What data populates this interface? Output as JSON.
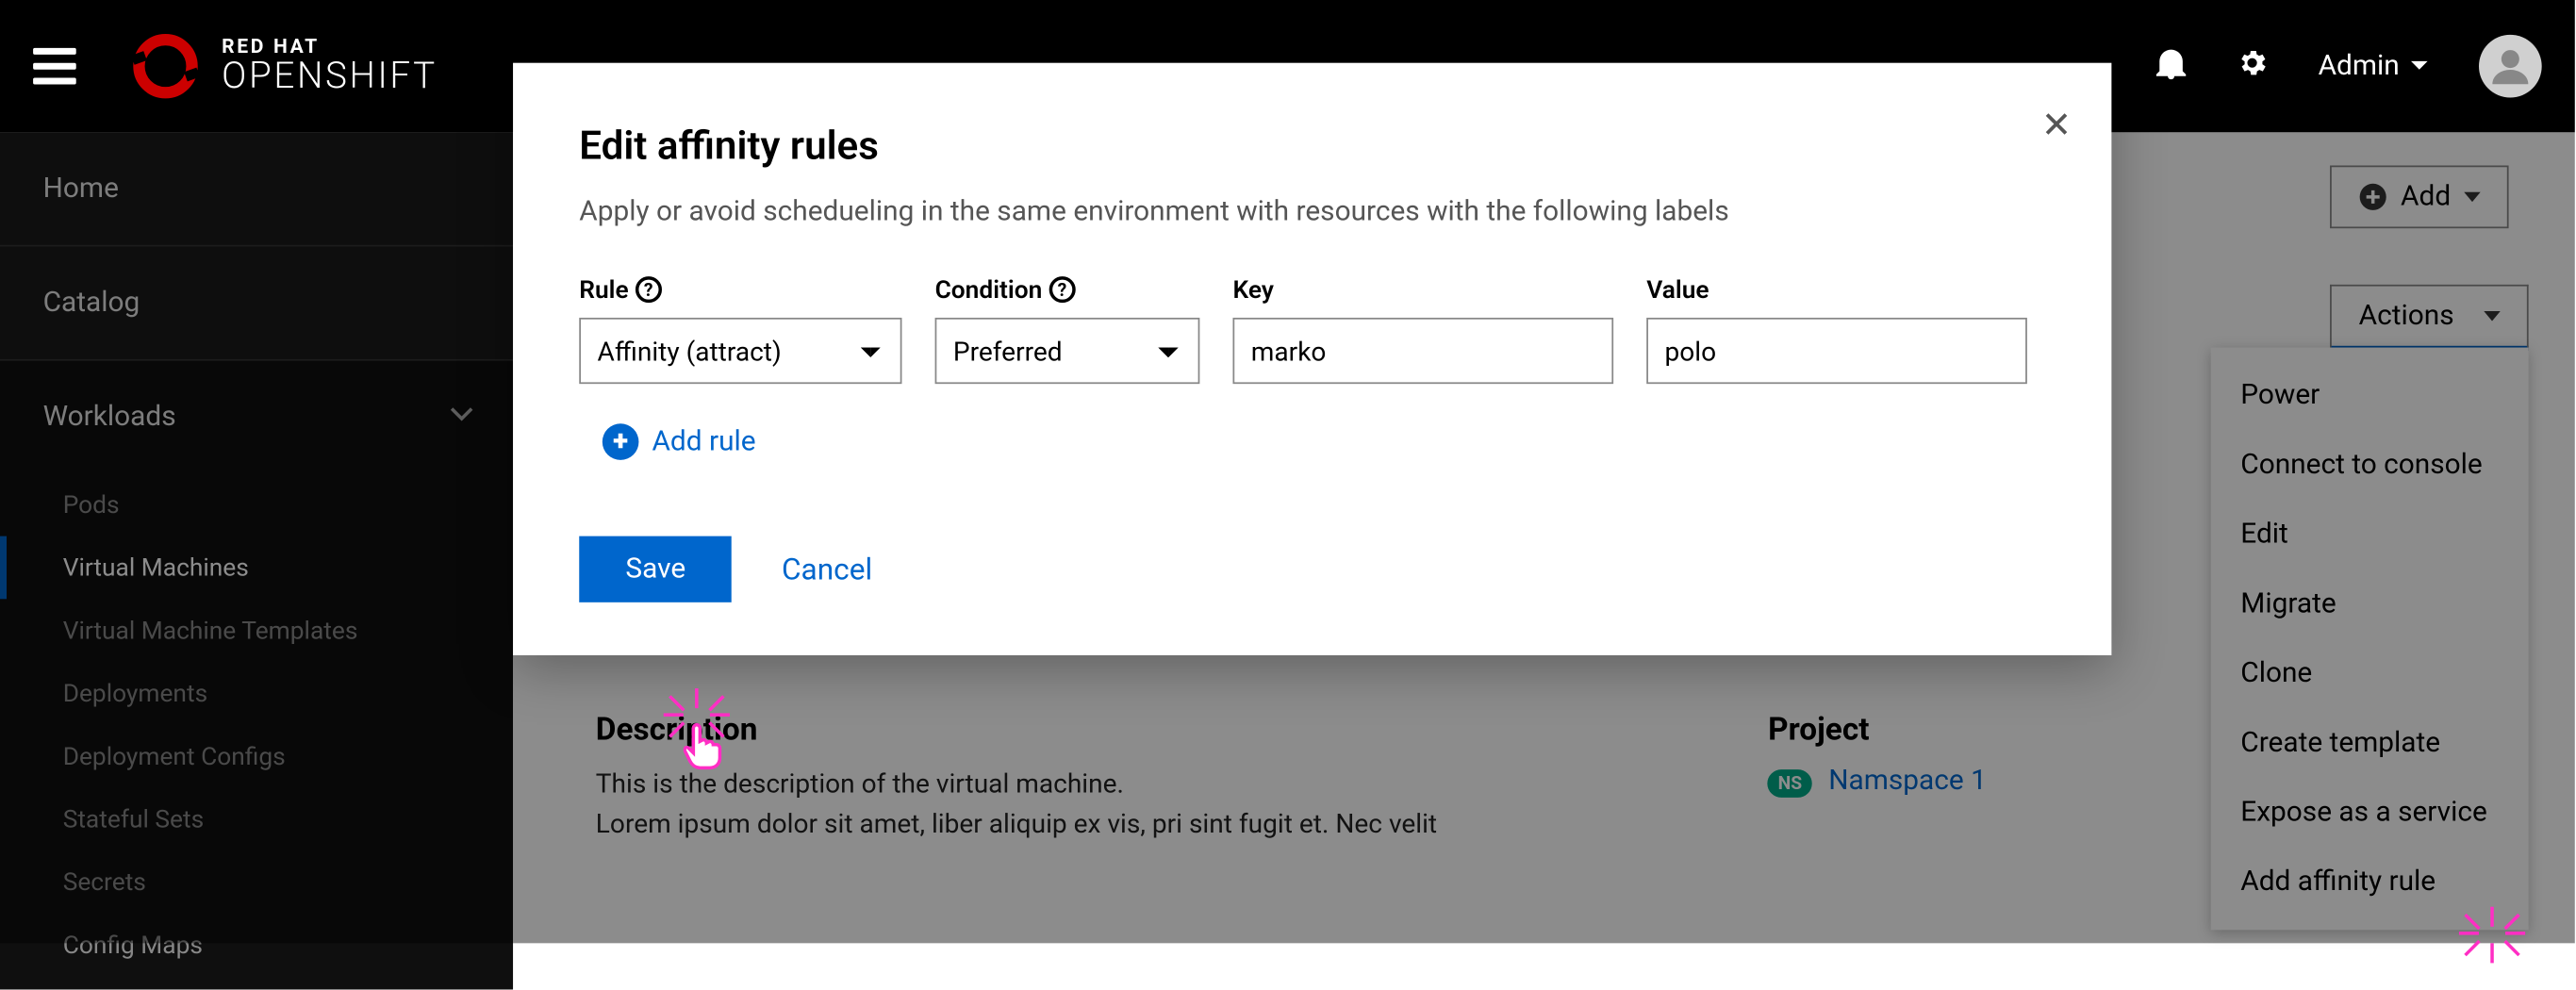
{
  "header": {
    "brand_top": "RED HAT",
    "brand_bottom": "OPENSHIFT",
    "user_label": "Admin"
  },
  "sidebar": {
    "items": [
      {
        "label": "Home"
      },
      {
        "label": "Catalog"
      },
      {
        "label": "Workloads"
      }
    ],
    "workloads_children": [
      {
        "label": "Pods"
      },
      {
        "label": "Virtual Machines"
      },
      {
        "label": "Virtual Machine Templates"
      },
      {
        "label": "Deployments"
      },
      {
        "label": "Deployment Configs"
      },
      {
        "label": "Stateful Sets"
      },
      {
        "label": "Secrets"
      },
      {
        "label": "Config Maps"
      }
    ]
  },
  "page": {
    "add_label": "Add",
    "actions_label": "Actions",
    "description_heading": "Description",
    "description_line1": "This is the description of the virtual machine.",
    "description_line2": "Lorem ipsum dolor sit amet, liber aliquip ex vis, pri sint fugit et. Nec velit",
    "project_heading": "Project",
    "ns_badge": "NS",
    "project_name": "Namspace 1"
  },
  "actions_menu": [
    "Power",
    "Connect to console",
    "Edit",
    "Migrate",
    "Clone",
    "Create template",
    "Expose as a service",
    "Add affinity rule"
  ],
  "modal": {
    "title": "Edit affinity rules",
    "subtitle": "Apply or avoid schedueling in the same environment with resources with the following labels",
    "labels": {
      "rule": "Rule",
      "condition": "Condition",
      "key": "Key",
      "value": "Value"
    },
    "row": {
      "rule": "Affinity (attract)",
      "condition": "Preferred",
      "key": "marko",
      "value": "polo"
    },
    "add_rule": "Add rule",
    "save": "Save",
    "cancel": "Cancel"
  }
}
